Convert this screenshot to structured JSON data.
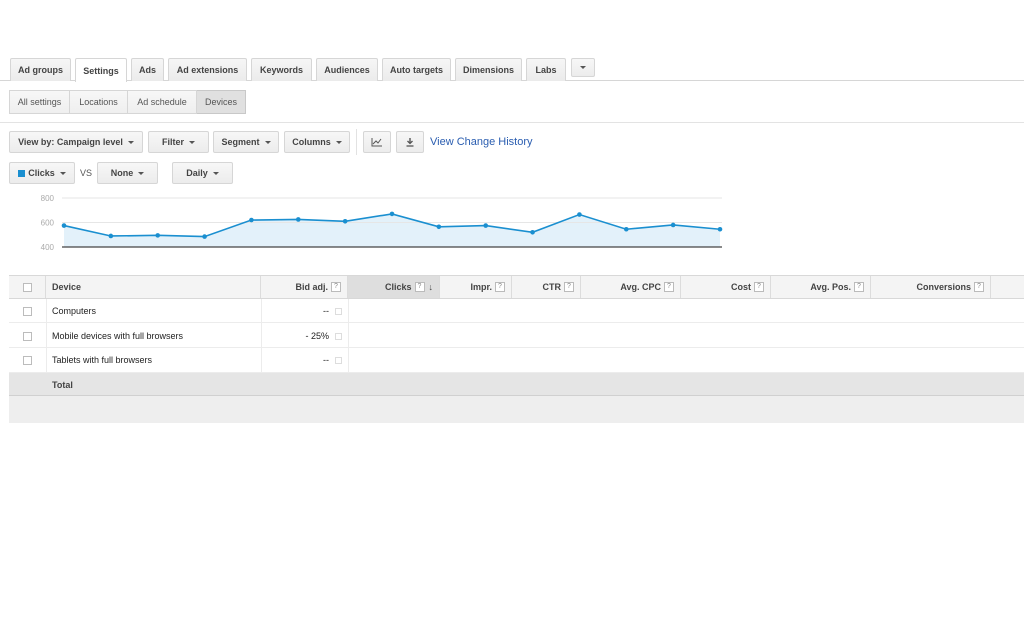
{
  "tabs": [
    {
      "label": "Ad groups"
    },
    {
      "label": "Settings"
    },
    {
      "label": "Ads"
    },
    {
      "label": "Ad extensions"
    },
    {
      "label": "Keywords"
    },
    {
      "label": "Audiences"
    },
    {
      "label": "Auto targets"
    },
    {
      "label": "Dimensions"
    },
    {
      "label": "Labs"
    }
  ],
  "active_tab": "Settings",
  "subtabs": [
    {
      "label": "All settings"
    },
    {
      "label": "Locations"
    },
    {
      "label": "Ad schedule"
    },
    {
      "label": "Devices"
    }
  ],
  "active_subtab": "Devices",
  "toolbar": {
    "view_by": "View by: Campaign level",
    "filter": "Filter",
    "segment": "Segment",
    "columns": "Columns",
    "chart_icon": "line-chart-icon",
    "download_icon": "download-icon",
    "change_history": "View Change History"
  },
  "chart_controls": {
    "metric1": "Clicks",
    "metric1_color": "#1a8fd0",
    "vs": "VS",
    "metric2": "None",
    "interval": "Daily"
  },
  "chart_data": {
    "type": "area",
    "x": [
      1,
      2,
      3,
      4,
      5,
      6,
      7,
      8,
      9,
      10,
      11,
      12,
      13,
      14,
      15
    ],
    "series": [
      {
        "values": [
          575,
          490,
          495,
          485,
          620,
          625,
          610,
          670,
          565,
          575,
          520,
          665,
          545,
          580,
          545
        ]
      }
    ],
    "y_ticks": [
      "800",
      "600",
      "400"
    ],
    "ylim": [
      400,
      800
    ],
    "grid": true,
    "line_color": "#1a8fd0",
    "fill_color": "#e3f1fa"
  },
  "table": {
    "columns": [
      {
        "label": "Device",
        "help": false
      },
      {
        "label": "Bid adj.",
        "help": true
      },
      {
        "label": "Clicks",
        "help": true,
        "sorted": true
      },
      {
        "label": "Impr.",
        "help": true
      },
      {
        "label": "CTR",
        "help": true
      },
      {
        "label": "Avg. CPC",
        "help": true
      },
      {
        "label": "Cost",
        "help": true
      },
      {
        "label": "Avg. Pos.",
        "help": true
      },
      {
        "label": "Conversions",
        "help": true
      }
    ],
    "help_glyph": "?",
    "sort_glyph": "↓",
    "rows": [
      {
        "device": "Computers",
        "bid_adj": "--"
      },
      {
        "device": "Mobile devices with full browsers",
        "bid_adj": "- 25%"
      },
      {
        "device": "Tablets with full browsers",
        "bid_adj": "--"
      }
    ],
    "total_label": "Total"
  }
}
